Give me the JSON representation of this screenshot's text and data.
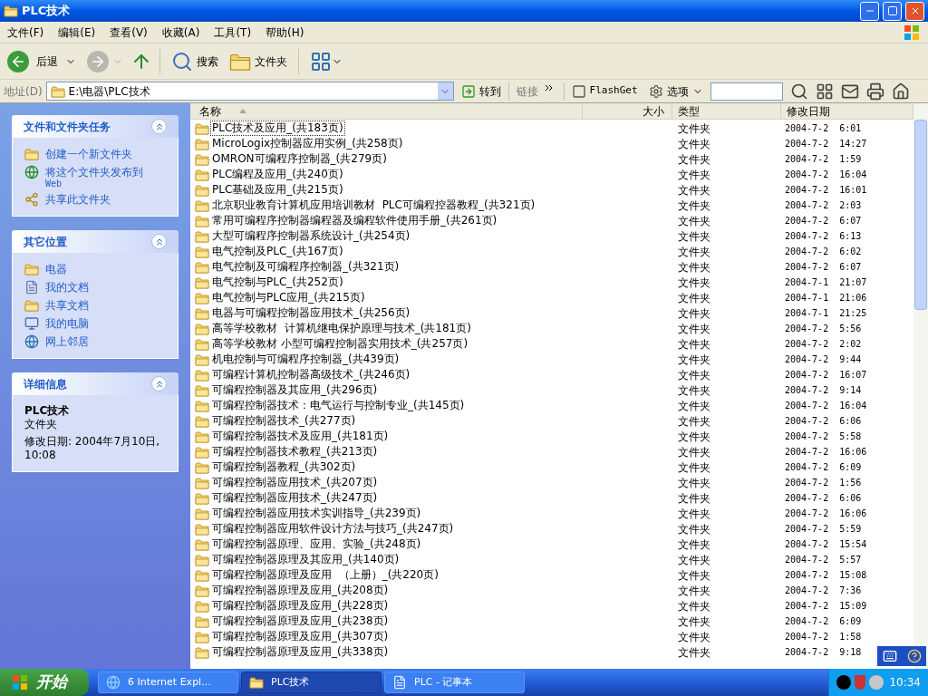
{
  "window": {
    "title": "PLC技术"
  },
  "menu": [
    "文件(F)",
    "编辑(E)",
    "查看(V)",
    "收藏(A)",
    "工具(T)",
    "帮助(H)"
  ],
  "toolbar": {
    "back": "后退",
    "search": "搜索",
    "folders": "文件夹"
  },
  "address": {
    "label": "地址(D)",
    "value": "E:\\电器\\PLC技术",
    "go": "转到",
    "links": "链接",
    "flashget": "FlashGet",
    "options": "选项"
  },
  "sidebar": [
    {
      "title": "文件和文件夹任务",
      "expanded": true,
      "items": [
        {
          "kind": "new-folder",
          "text": "创建一个新文件夹"
        },
        {
          "kind": "web",
          "text": "将这个文件夹发布到",
          "sub": "Web"
        },
        {
          "kind": "share",
          "text": "共享此文件夹"
        }
      ]
    },
    {
      "title": "其它位置",
      "expanded": true,
      "items": [
        {
          "kind": "folder",
          "text": "电器"
        },
        {
          "kind": "documents",
          "text": "我的文档"
        },
        {
          "kind": "folder",
          "text": "共享文档"
        },
        {
          "kind": "computer",
          "text": "我的电脑"
        },
        {
          "kind": "network",
          "text": "网上邻居"
        }
      ]
    },
    {
      "title": "详细信息",
      "expanded": true,
      "details": {
        "name": "PLC技术",
        "type": "文件夹",
        "modified": "修改日期: 2004年7月10日, 10:08"
      }
    }
  ],
  "table": {
    "columns": [
      "名称",
      "大小",
      "类型",
      "修改日期"
    ],
    "rows": [
      {
        "name": "PLC技术及应用_(共183页)",
        "type": "文件夹",
        "date": "2004-7-2  6:01",
        "selected": true
      },
      {
        "name": "MicroLogix控制器应用实例_(共258页)",
        "type": "文件夹",
        "date": "2004-7-2  14:27",
        "selected": false
      },
      {
        "name": "OMRON可编程序控制器_(共279页)",
        "type": "文件夹",
        "date": "2004-7-2  1:59",
        "selected": false
      },
      {
        "name": "PLC编程及应用_(共240页)",
        "type": "文件夹",
        "date": "2004-7-2  16:04",
        "selected": false
      },
      {
        "name": "PLC基础及应用_(共215页)",
        "type": "文件夹",
        "date": "2004-7-2  16:01",
        "selected": false
      },
      {
        "name": "北京职业教育计算机应用培训教材  PLC可编程控器教程_(共321页)",
        "type": "文件夹",
        "date": "2004-7-2  2:03",
        "selected": false
      },
      {
        "name": "常用可编程序控制器编程器及编程软件使用手册_(共261页)",
        "type": "文件夹",
        "date": "2004-7-2  6:07",
        "selected": false
      },
      {
        "name": "大型可编程序控制器系统设计_(共254页)",
        "type": "文件夹",
        "date": "2004-7-2  6:13",
        "selected": false
      },
      {
        "name": "电气控制及PLC_(共167页)",
        "type": "文件夹",
        "date": "2004-7-2  6:02",
        "selected": false
      },
      {
        "name": "电气控制及可编程序控制器_(共321页)",
        "type": "文件夹",
        "date": "2004-7-2  6:07",
        "selected": false
      },
      {
        "name": "电气控制与PLC_(共252页)",
        "type": "文件夹",
        "date": "2004-7-1  21:07",
        "selected": false
      },
      {
        "name": "电气控制与PLC应用_(共215页)",
        "type": "文件夹",
        "date": "2004-7-1  21:06",
        "selected": false
      },
      {
        "name": "电器与可编程控制器应用技术_(共256页)",
        "type": "文件夹",
        "date": "2004-7-1  21:25",
        "selected": false
      },
      {
        "name": "高等学校教材  计算机继电保护原理与技术_(共181页)",
        "type": "文件夹",
        "date": "2004-7-2  5:56",
        "selected": false
      },
      {
        "name": "高等学校教材 小型可编程控制器实用技术_(共257页)",
        "type": "文件夹",
        "date": "2004-7-2  2:02",
        "selected": false
      },
      {
        "name": "机电控制与可编程序控制器_(共439页)",
        "type": "文件夹",
        "date": "2004-7-2  9:44",
        "selected": false
      },
      {
        "name": "可编程计算机控制器高级技术_(共246页)",
        "type": "文件夹",
        "date": "2004-7-2  16:07",
        "selected": false
      },
      {
        "name": "可编程控制器及其应用_(共296页)",
        "type": "文件夹",
        "date": "2004-7-2  9:14",
        "selected": false
      },
      {
        "name": "可编程控制器技术：电气运行与控制专业_(共145页)",
        "type": "文件夹",
        "date": "2004-7-2  16:04",
        "selected": false
      },
      {
        "name": "可编程控制器技术_(共277页)",
        "type": "文件夹",
        "date": "2004-7-2  6:06",
        "selected": false
      },
      {
        "name": "可编程控制器技术及应用_(共181页)",
        "type": "文件夹",
        "date": "2004-7-2  5:58",
        "selected": false
      },
      {
        "name": "可编程控制器技术教程_(共213页)",
        "type": "文件夹",
        "date": "2004-7-2  16:06",
        "selected": false
      },
      {
        "name": "可编程控制器教程_(共302页)",
        "type": "文件夹",
        "date": "2004-7-2  6:09",
        "selected": false
      },
      {
        "name": "可编程控制器应用技术_(共207页)",
        "type": "文件夹",
        "date": "2004-7-2  1:56",
        "selected": false
      },
      {
        "name": "可编程控制器应用技术_(共247页)",
        "type": "文件夹",
        "date": "2004-7-2  6:06",
        "selected": false
      },
      {
        "name": "可编程控制器应用技术实训指导_(共239页)",
        "type": "文件夹",
        "date": "2004-7-2  16:06",
        "selected": false
      },
      {
        "name": "可编程控制器应用软件设计方法与技巧_(共247页)",
        "type": "文件夹",
        "date": "2004-7-2  5:59",
        "selected": false
      },
      {
        "name": "可编程控制器原理、应用、实验_(共248页)",
        "type": "文件夹",
        "date": "2004-7-2  15:54",
        "selected": false
      },
      {
        "name": "可编程控制器原理及其应用_(共140页)",
        "type": "文件夹",
        "date": "2004-7-2  5:57",
        "selected": false
      },
      {
        "name": "可编程控制器原理及应用  （上册）_(共220页)",
        "type": "文件夹",
        "date": "2004-7-2  15:08",
        "selected": false
      },
      {
        "name": "可编程控制器原理及应用_(共208页)",
        "type": "文件夹",
        "date": "2004-7-2  7:36",
        "selected": false
      },
      {
        "name": "可编程控制器原理及应用_(共228页)",
        "type": "文件夹",
        "date": "2004-7-2  15:09",
        "selected": false
      },
      {
        "name": "可编程控制器原理及应用_(共238页)",
        "type": "文件夹",
        "date": "2004-7-2  6:09",
        "selected": false
      },
      {
        "name": "可编程控制器原理及应用_(共307页)",
        "type": "文件夹",
        "date": "2004-7-2  1:58",
        "selected": false
      },
      {
        "name": "可编程控制器原理及应用_(共338页)",
        "type": "文件夹",
        "date": "2004-7-2  9:18",
        "selected": false
      }
    ]
  },
  "taskbar": {
    "start": "开始",
    "tasks": [
      {
        "label": "6 Internet Expl...",
        "kind": "browser",
        "selected": false
      },
      {
        "label": "PLC技术",
        "kind": "folder",
        "selected": true
      },
      {
        "label": "PLC - 记事本",
        "kind": "notepad",
        "selected": false
      }
    ],
    "clock": "10:34"
  }
}
